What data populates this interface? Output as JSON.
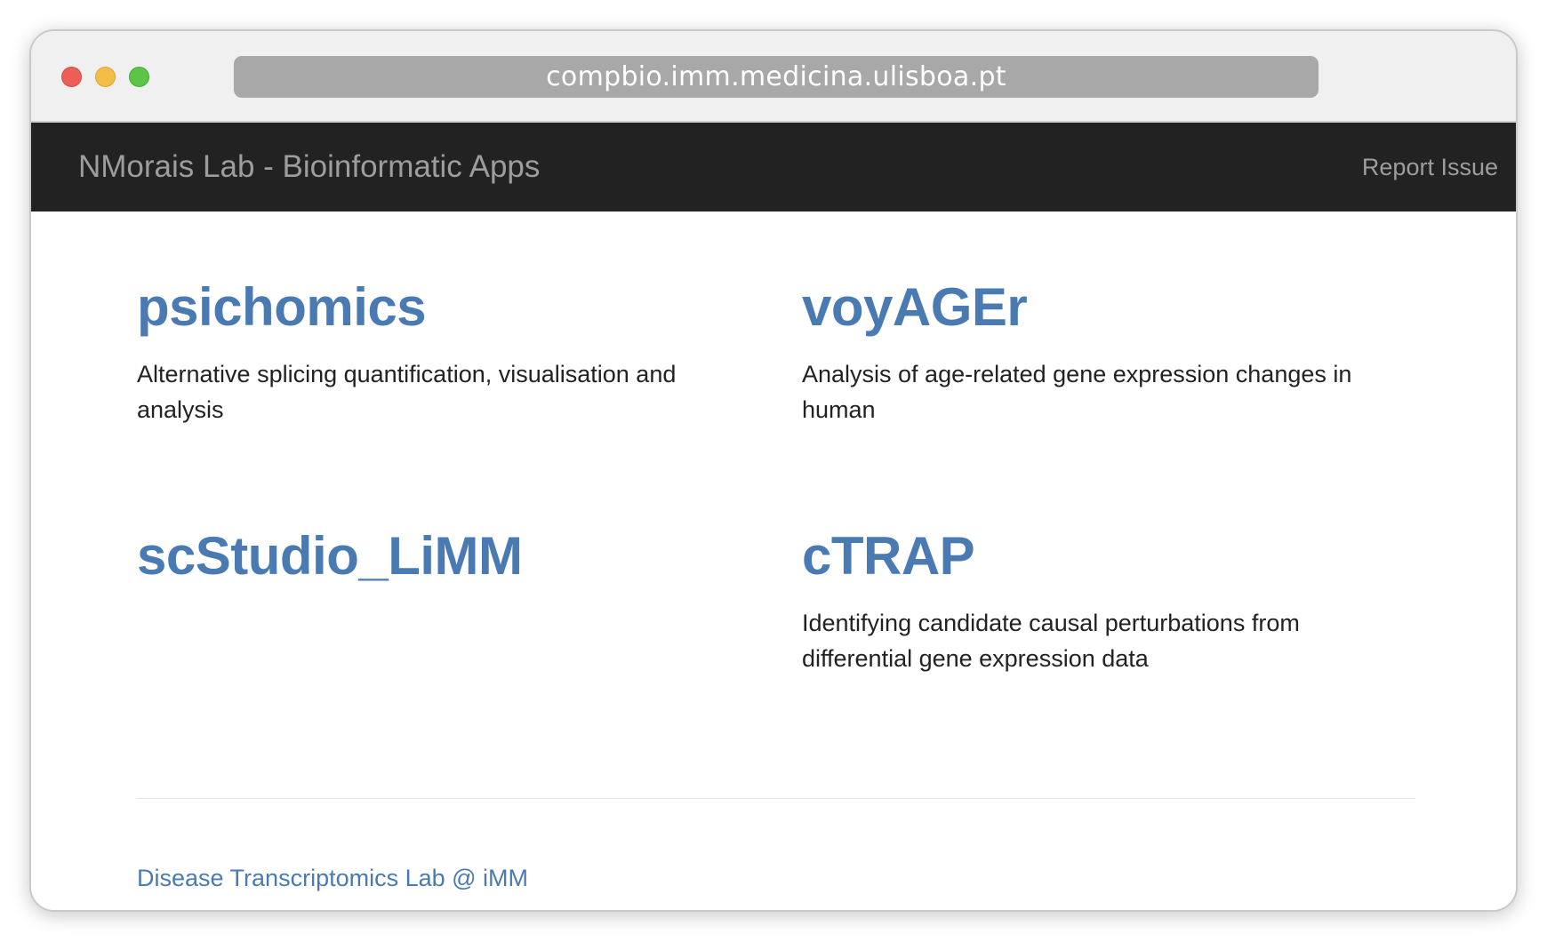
{
  "browser": {
    "url": "compbio.imm.medicina.ulisboa.pt"
  },
  "navbar": {
    "brand": "NMorais Lab - Bioinformatic Apps",
    "report_issue": "Report Issue"
  },
  "apps": [
    {
      "title": "psichomics",
      "description": "Alternative splicing quantification, visualisation and analysis"
    },
    {
      "title": "voyAGEr",
      "description": "Analysis of age-related gene expression changes in human"
    },
    {
      "title": "scStudio_LiMM",
      "description": ""
    },
    {
      "title": "cTRAP",
      "description": "Identifying candidate causal perturbations from differential gene expression data"
    }
  ],
  "footer": {
    "link": "Disease Transcriptomics Lab @ iMM"
  },
  "colors": {
    "link": "#4a7ab2",
    "navbar_bg": "#222222",
    "navbar_text": "#9d9d9d"
  }
}
